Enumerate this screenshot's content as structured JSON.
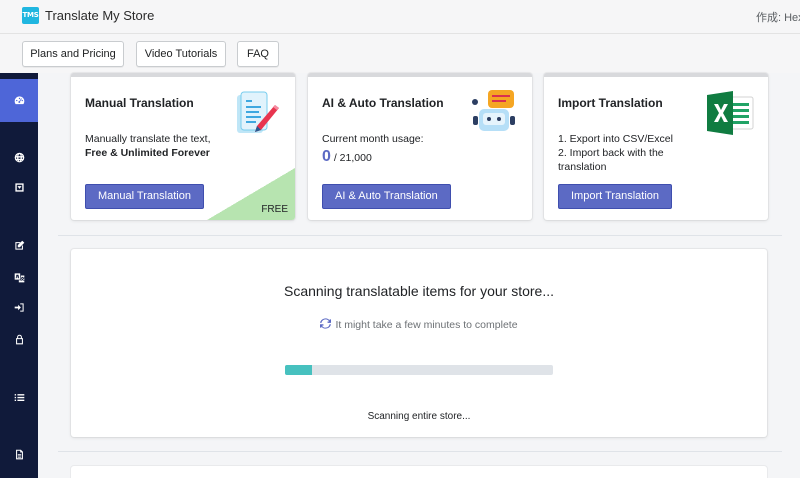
{
  "header": {
    "logo_text": "TMS",
    "title": "Translate My Store",
    "author": "作成: Hextom"
  },
  "nav": {
    "buttons": [
      "Plans and Pricing",
      "Video Tutorials",
      "FAQ"
    ]
  },
  "sidebar": {
    "icons": [
      "dashboard-icon",
      "globe-icon",
      "inbox-icon",
      "edit-icon",
      "translate-icon",
      "sign-in-icon",
      "user-icon",
      "list-icon",
      "document-icon"
    ],
    "active": "dashboard-icon"
  },
  "cards": [
    {
      "title": "Manual Translation",
      "text_line1": "Manually translate the text,",
      "text_line2": "Free & Unlimited Forever",
      "button": "Manual Translation",
      "badge": "FREE",
      "icon": "document-pen-icon"
    },
    {
      "title": "AI & Auto Translation",
      "usage_label": "Current month usage:",
      "usage_used": "0",
      "usage_total": "/ 21,000",
      "button": "AI & Auto Translation",
      "icon": "robot-icon"
    },
    {
      "title": "Import Translation",
      "text_line1": "1. Export into CSV/Excel",
      "text_line2": "2. Import back with the",
      "text_line3": "translation",
      "button": "Import Translation",
      "icon": "excel-icon"
    }
  ],
  "scan": {
    "title": "Scanning translatable items for your store...",
    "note": "It might take a few minutes to complete",
    "progress": 0.1,
    "status": "Scanning entire store..."
  },
  "colors": {
    "accent": "#5c6ac4",
    "sidebar": "#101a3a",
    "sidebar_active": "#4e66d8",
    "progress": "#47c1bf",
    "free_badge": "#b7e4b0"
  }
}
